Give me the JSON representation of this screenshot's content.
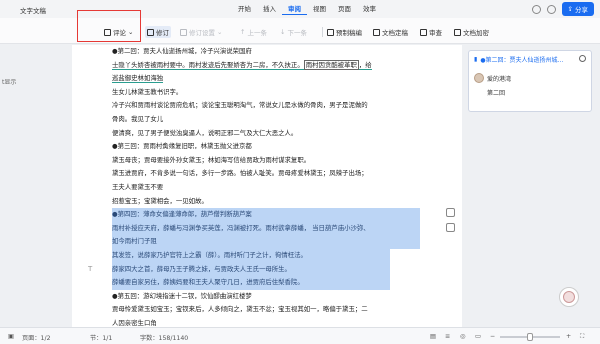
{
  "window": {
    "doc_title": "文字文稿",
    "menu": [
      "开始",
      "插入",
      "审阅",
      "视图",
      "页面",
      "效率"
    ],
    "active_menu_index": 2,
    "share_label": "分享",
    "accent_color": "#1a6cf0"
  },
  "toolbar": {
    "comment": "评论",
    "track_changes": "修订",
    "track_settings": "修订设置",
    "prev": "上一条",
    "next": "下一条",
    "final_state": "预制稿编",
    "compare": "文档定稿",
    "review_panel": "审查",
    "encrypt": "文档加密"
  },
  "left": {
    "gutter_text": "t显示"
  },
  "document": {
    "lines": [
      [
        {
          "t": "●第二回：贾夫人仙逝扬州城，冷子兴演说荣国府",
          "c": ""
        }
      ],
      [
        {
          "t": "士隐丫头娇杏被雨村要中。雨村发迹后先娶娇杏为二房，不久扶正。",
          "c": "ul"
        },
        {
          "t": "雨村因贪酷被革职",
          "c": "boxed"
        },
        {
          "t": "，给",
          "c": "ul"
        }
      ],
      [
        {
          "t": "巡盐御史林如海独",
          "c": "ul"
        }
      ],
      [
        {
          "t": "生女儿林黛玉教书识字。",
          "c": ""
        }
      ],
      [
        {
          "t": "冷子兴和贾雨村谈论贾府危机；谈论宝玉聪明淘气，常说女儿是水做的骨肉，男子是泥做的",
          "c": ""
        }
      ],
      [
        {
          "t": "骨肉。我见了女儿",
          "c": ""
        }
      ],
      [
        {
          "t": "便清爽，见了男子便觉浊臭逼人，说明正邪二气及大仁大恶之人。",
          "c": ""
        }
      ],
      [
        {
          "t": "●第三回：贾雨村夤缘复旧职，林黛玉抛父进京都",
          "c": ""
        }
      ],
      [
        {
          "t": "黛玉母丧；贾母要接外孙女黛玉；林如海写信给贾政为雨村谋求复职。",
          "c": ""
        }
      ],
      [
        {
          "t": "黛玉进贾府，不肯多说一句话，多行一步路。怕被人耻笑。贾母疼爱林黛玉；凤辣子出场；",
          "c": ""
        }
      ],
      [
        {
          "t": "王夫人要黛玉不要",
          "c": ""
        }
      ],
      [
        {
          "t": "招惹宝玉；宝黛相会，一见如故。",
          "c": ""
        }
      ],
      [
        {
          "t": "●第四回：薄命女偏逢薄命郎，葫芦僧判断葫芦案",
          "c": "sel"
        }
      ],
      [
        {
          "t": "雨村补授应天府，薛蟠与冯渊争买英莲，冯渊被打死。雨村欲拿薛蟠，  当日葫芦庙小沙弥、",
          "c": "sel"
        }
      ],
      [
        {
          "t": "如今雨村门子阻",
          "c": "sel"
        }
      ],
      [
        {
          "t": "其发签，说薛家乃护官符上之霸（薛）。雨村听门子之计，徇情枉法。",
          "c": "sel full"
        }
      ],
      [
        {
          "t": "薛家四大之首，薛母乃王子腾之妹，与贾政夫人王氏一母所生。",
          "c": "sel full"
        }
      ],
      [
        {
          "t": "薛蟠要自家另住，薛姨妈要和王夫人聚守几日，进贾府后住梨香院。",
          "c": "sel full"
        }
      ],
      [
        {
          "t": "●第五回：游幻境指迷十二钗，饮仙醪曲演红楼梦",
          "c": ""
        }
      ],
      [
        {
          "t": "贾母怜爱黛玉如宝玉；宝钗来后，人多倾向之，黛玉不忿；宝玉视其如一，略偏于黛玉；二",
          "c": ""
        }
      ],
      [
        {
          "t": "人因亲密生口角",
          "c": ""
        }
      ]
    ]
  },
  "comments": {
    "header": "●第二回：贾夫人仙逝扬州城...",
    "user": "爱的港湾",
    "body": "第二回"
  },
  "status": {
    "page": "页面：1/2",
    "section": "节：1/1",
    "words_label": "字数：158/1140",
    "zoom": "+"
  }
}
